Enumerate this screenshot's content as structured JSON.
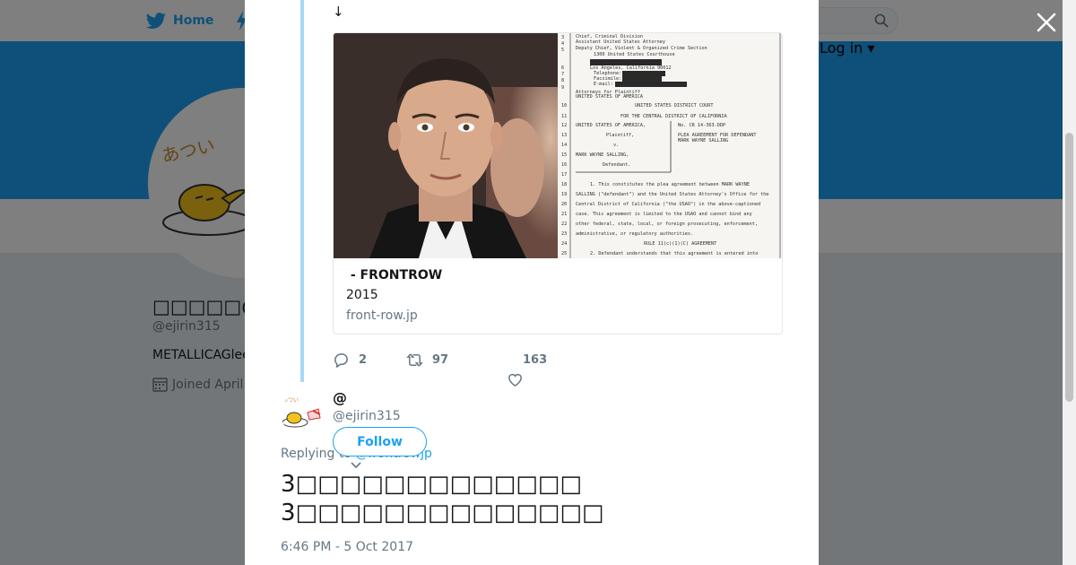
{
  "nav": {
    "home_label": "Home",
    "login_label": "Log in ▾"
  },
  "profile": {
    "display_name": "□□□□□@□□",
    "handle": "@ejirin315",
    "bio": "METALLICAGlee",
    "joined": "Joined April"
  },
  "thread": {
    "arrow_text": "↓",
    "link_card": {
      "title": " - FRONTROW",
      "description": "2015",
      "domain": "front-row.jp"
    },
    "actions": {
      "replies": "2",
      "retweets": "97",
      "likes": "163"
    }
  },
  "reply": {
    "display_name": "@",
    "handle": "@ejirin315",
    "follow_label": "Follow",
    "replying_prefix": "Replying to ",
    "replying_to": "@frontrowjp",
    "text_line1": "3□□□□□□□□□□□□□",
    "text_line2": "3□□□□□□□□□□□□□□",
    "timestamp": "6:46 PM - 5 Oct 2017"
  },
  "colors": {
    "brand": "#1da1f2",
    "thread_line": "#a6d8f5",
    "secondary_text": "#657786"
  },
  "icons": [
    "twitter-bird-icon",
    "lightning-icon",
    "search-icon",
    "calendar-icon",
    "close-icon",
    "reply-icon",
    "retweet-icon",
    "heart-icon",
    "chevron-down-icon"
  ]
}
